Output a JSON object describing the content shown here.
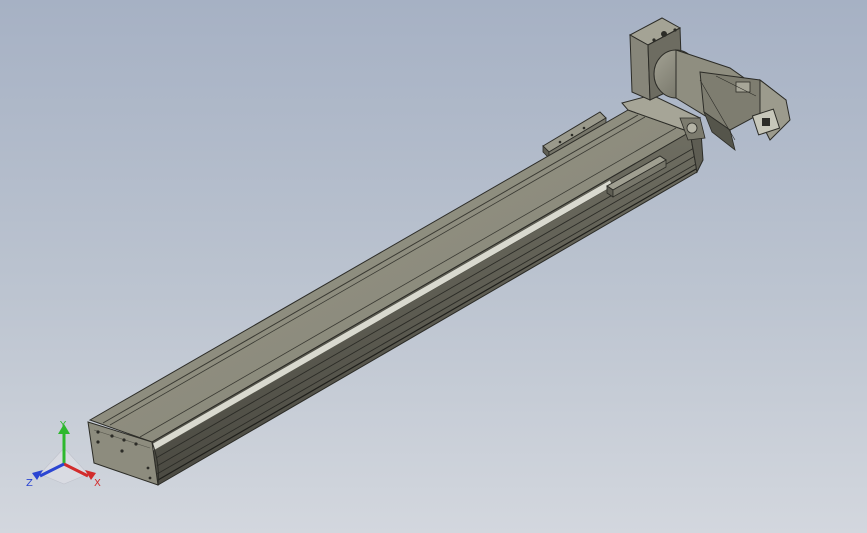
{
  "viewport": {
    "background_top": "#a6b1c4",
    "background_bottom": "#d3d7de"
  },
  "model": {
    "body_color": "#8e8d7e",
    "edge_color": "#2c2c27",
    "highlight_color": "#d9d9cf",
    "motor_color": "#8f8e80",
    "motor_cap_color": "#c7c7ba",
    "components": [
      "linear-actuator-rail",
      "carriage-block",
      "motor-mount-bracket",
      "servo-motor",
      "end-cap"
    ]
  },
  "triad": {
    "x_label": "X",
    "y_label": "Y",
    "z_label": "Z",
    "x_color": "#d22b2b",
    "y_color": "#2eb82e",
    "z_color": "#2b45d2"
  }
}
